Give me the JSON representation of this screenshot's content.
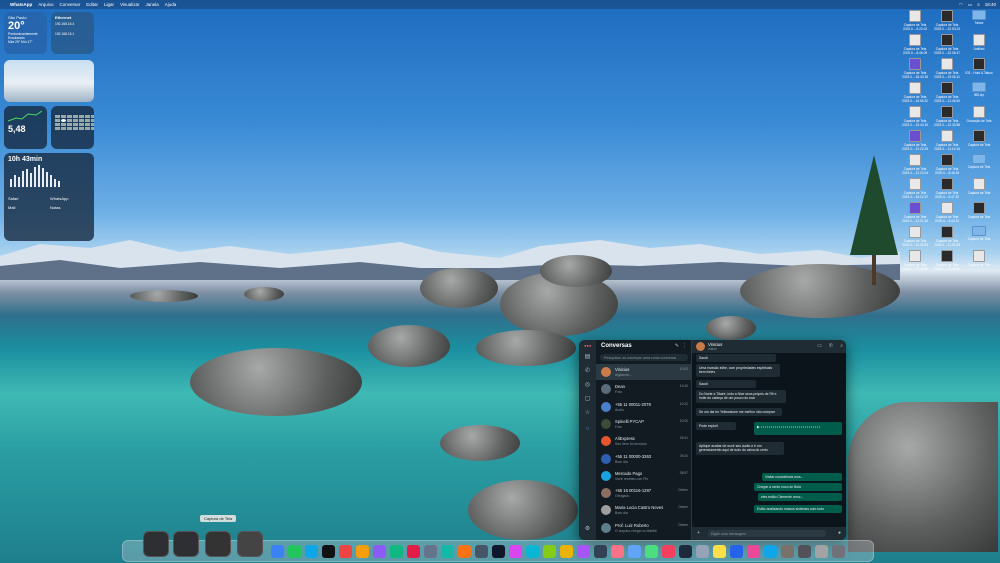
{
  "menubar": {
    "apple": "",
    "app": "WhatsApp",
    "items": [
      "Arquivo",
      "Conversar",
      "Editar",
      "Ligar",
      "Visualizar",
      "Janela",
      "Ajuda"
    ],
    "clock": "18:40"
  },
  "widgets": {
    "weather": {
      "city": "São Paulo",
      "temp": "20°",
      "cond": "Predominantemente Ensolarado",
      "range": "Máx 29° Mín 17°"
    },
    "ethernet": {
      "title": "Ethernet",
      "line1": "192.168.15.4",
      "line2": "192.168.15.1"
    },
    "stocks": {
      "label": "5,48"
    },
    "screentime": {
      "title": "10h 43min",
      "rows": [
        "Safari",
        "WhatsApp",
        "Mail",
        "Notas"
      ]
    }
  },
  "desktop_items": [
    "Captura de Tela 2025-0...-8.23.02",
    "Captura de Tela 2025-0...-22.53.23",
    "Tahoe",
    "Captura de Tela 2025-0...-8.46.09",
    "Captura de Tela 2025-0...-22.08.47",
    "Untitled",
    "Captura de Tela 2025-0...-18.43.18",
    "Captura de Tela 2025-0...-19.06.11",
    "031 - Hunt & Taboo",
    "Captura de Tela 2025-0...-16.56.32",
    "Captura de Tela 2025-0...-11.46.53",
    "IBS.zip",
    "Captura de Tela 2025-0...-15.44.15",
    "Captura de Tela 2025-0...-12.33.58",
    "Gravação de Tela",
    "Captura de Tela 2025-0...-21.22.25",
    "Captura de Tela 2025-0...-11.14.16",
    "Captura de Tela",
    "Captura de Tela 2025-0...-21.23.24",
    "Captura de Tela 2025-0...-8.46.54",
    "Captura de Tela",
    "Captura de Tela 2025-0...-16.12.37",
    "Captura de Tela 2025-0...-9.47.52",
    "Captura de Tela",
    "Captura de Tela 2025-0...-21.21.36",
    "Captura de Tela 2025-0...-9.44.10",
    "Captura de Tela",
    "Captura de Tela 2025-0...-14.00.23",
    "Captura de Tela 2025-0...-11.00.43",
    "Captura de Tela",
    "Captura de Tela 2025-0...-17.46.43",
    "Captura de Tela 2025-0...-21.49.51",
    "Captura de Tela"
  ],
  "whatsapp": {
    "title": "Conversas",
    "search_placeholder": "Pesquisar ou começar uma nova conversa",
    "chats": [
      {
        "name": "Vinicius",
        "preview": "digitando...",
        "time": "10:53",
        "color": "#c97b4a"
      },
      {
        "name": "Dean",
        "preview": "Foto",
        "time": "10:40",
        "color": "#5b6b7a"
      },
      {
        "name": "+55 11 00011-2079",
        "preview": "Áudio",
        "time": "10:22",
        "color": "#4a7fc9"
      },
      {
        "name": "Spinelli PYCAP",
        "preview": "Foto",
        "time": "10:00",
        "color": "#3c4b3a"
      },
      {
        "name": "AliExpress",
        "preview": "Seu item foi enviado",
        "time": "09:41",
        "color": "#e5552e"
      },
      {
        "name": "+55 11 00000-3263",
        "preview": "Bom dia",
        "time": "09:20",
        "color": "#2f5fb3"
      },
      {
        "name": "Mercado Pago",
        "preview": "Você recebeu um Pix",
        "time": "08:57",
        "color": "#1aa3e0"
      },
      {
        "name": "+55 16 00116-1297",
        "preview": "Obrigado",
        "time": "Ontem",
        "color": "#8d6e63"
      },
      {
        "name": "Maria Lucia Castro Neves",
        "preview": "Bom dia",
        "time": "Ontem",
        "color": "#9e9e9e"
      },
      {
        "name": "Prof. Luiz Roberto",
        "preview": "O arquivo chega no Mailbit",
        "time": "Ontem",
        "color": "#607d8b"
      }
    ],
    "conversation": {
      "name": "Vinicius",
      "status": "online",
      "messages": [
        {
          "dir": "in",
          "text": "Saudi"
        },
        {
          "dir": "in",
          "text": "Uma invasão inibe, com propriedades espirituais bem fortes"
        },
        {
          "dir": "in",
          "text": "Saudi"
        },
        {
          "dir": "in",
          "text": "Do Norte a Tikaré, indo a Nice seus própris de Rit e Indie do cabeça de um pouco do mar"
        },
        {
          "dir": "in",
          "text": "Se um dia for Yellowstone me melhor não comprar"
        },
        {
          "dir": "in",
          "text": "Pode exploit"
        },
        {
          "dir": "in",
          "text": "Aplique acabar de ouvir seu áudio e é um gerenciamento aqui de tudo do caixa do certo"
        },
        {
          "dir": "out",
          "text": "Visitar concidência mos..."
        },
        {
          "dir": "out",
          "text": "Chegar a cento novo de Bola"
        },
        {
          "dir": "out",
          "text": "eles estão Clemente arroz..."
        },
        {
          "dir": "out",
          "text": "Estão analisando nossos sistemas com todo"
        }
      ],
      "input_placeholder": "Digite uma mensagem"
    }
  },
  "dock": {
    "tooltip": "Captura de Tela"
  }
}
